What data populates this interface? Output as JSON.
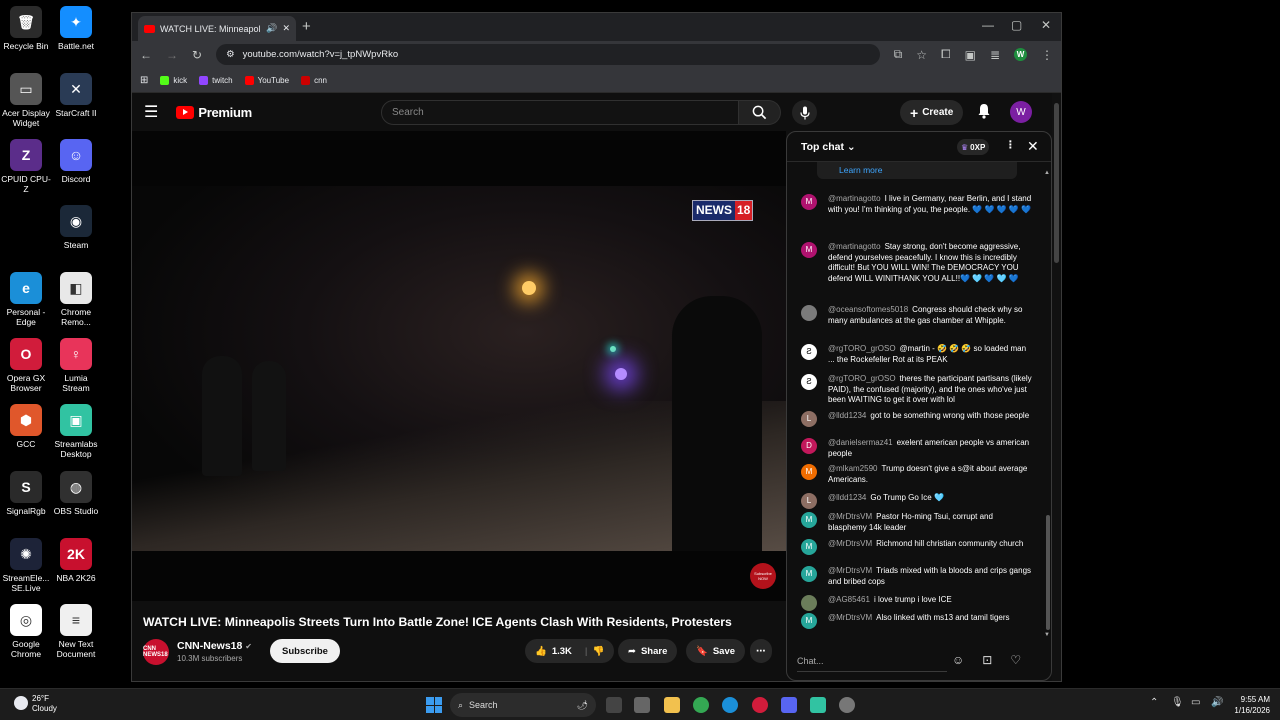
{
  "desktop": {
    "icons": [
      {
        "label": "Recycle Bin",
        "glyph": "🗑",
        "color": "#2b2b2b"
      },
      {
        "label": "Battle.net",
        "glyph": "✦",
        "color": "#148eff"
      },
      {
        "label": "Acer Display Widget",
        "glyph": "▭",
        "color": "#555555"
      },
      {
        "label": "StarCraft II",
        "glyph": "✕",
        "color": "#2a3b55"
      },
      {
        "label": "CPUID CPU-Z",
        "glyph": "Z",
        "color": "#5b2d8a"
      },
      {
        "label": "Discord",
        "glyph": "☺",
        "color": "#5865f2"
      },
      {
        "label": "Steam",
        "glyph": "◉",
        "color": "#1b2838"
      },
      {
        "label": "Personal - Edge",
        "glyph": "e",
        "color": "#1b8fd8"
      },
      {
        "label": "Chrome Remo...",
        "glyph": "◧",
        "color": "#e8e8e8"
      },
      {
        "label": "Opera GX Browser",
        "glyph": "O",
        "color": "#d11c3b"
      },
      {
        "label": "Lumia Stream",
        "glyph": "♀",
        "color": "#e8345a"
      },
      {
        "label": "GCC",
        "glyph": "⬢",
        "color": "#e0572b"
      },
      {
        "label": "Streamlabs Desktop",
        "glyph": "▣",
        "color": "#31c3a2"
      },
      {
        "label": "SignalRgb",
        "glyph": "S",
        "color": "#2a2a2a"
      },
      {
        "label": "OBS Studio",
        "glyph": "◍",
        "color": "#303030"
      },
      {
        "label": "StreamEle... SE.Live",
        "glyph": "✺",
        "color": "#1d2338"
      },
      {
        "label": "NBA 2K26",
        "glyph": "2K",
        "color": "#c8102e"
      },
      {
        "label": "Google Chrome",
        "glyph": "◎",
        "color": "#ffffff"
      },
      {
        "label": "New Text Document",
        "glyph": "≡",
        "color": "#f0f0f0"
      }
    ]
  },
  "browser": {
    "tab_title": "WATCH LIVE: Minneapolis S",
    "new_tab": "+",
    "url": "youtube.com/watch?v=j_tpNWpvRko",
    "profile_initial": "W",
    "bookmarks": [
      {
        "label": "kick",
        "color": "#53fc18"
      },
      {
        "label": "twitch",
        "color": "#9146ff"
      },
      {
        "label": "YouTube",
        "color": "#ff0000"
      },
      {
        "label": "cnn",
        "color": "#cc0000"
      }
    ]
  },
  "youtube": {
    "logo_text": "Premium",
    "search_placeholder": "Search",
    "create_label": "Create",
    "avatar_initial": "W",
    "video": {
      "title": "WATCH LIVE: Minneapolis Streets Turn Into Battle Zone! ICE Agents Clash With Residents, Protesters",
      "news_brand": "NEWS",
      "news_number": "18",
      "subscribe_watermark": "Subscribe NOW"
    },
    "channel": {
      "name": "CNN-News18",
      "subscribers": "10.3M subscribers",
      "subscribe_label": "Subscribe",
      "avatar_text": "CNN NEWS18"
    },
    "actions": {
      "likes": "1.3K",
      "share_label": "Share",
      "save_label": "Save"
    }
  },
  "chat": {
    "header": "Top chat",
    "xp": "0XP",
    "learn_more": "Learn more",
    "input_placeholder": "Chat...",
    "messages": [
      {
        "initial": "M",
        "color": "#b0126f",
        "author": "@martinagotto",
        "text": "I live in Germany, near Berlin, and I stand with you! I'm thinking of you, the people. 💙 💙 💙 💙 💙"
      },
      {
        "initial": "M",
        "color": "#b0126f",
        "author": "@martinagotto",
        "text": "Stay strong, don't become aggressive, defend yourselves peacefully. I know this is incredibly difficult! But YOU WILL WIN! The DEMOCRACY YOU defend WILL WINITHANK YOU ALL!!💙 🩵 💙 🩵 💙"
      },
      {
        "initial": "",
        "color": "#7a7a7a",
        "author": "@oceansoftomes5018",
        "text": "Congress should check why so many ambulances at the gas chamber at Whipple."
      },
      {
        "initial": "Ƨ",
        "color": "#ffffff",
        "author": "@rgTORO_grOSO",
        "text": "@martin - 🤣 🤣 🤣 so loaded man ... the Rockefeller Rot at its PEAK"
      },
      {
        "initial": "Ƨ",
        "color": "#ffffff",
        "author": "@rgTORO_grOSO",
        "text": "theres the participant partisans (likely PAID), the confused (majority), and the ones who've just been WAITING to get it over with lol"
      },
      {
        "initial": "L",
        "color": "#8d6e63",
        "author": "@lldd1234",
        "text": "got to be something wrong with those people"
      },
      {
        "initial": "D",
        "color": "#c2185b",
        "author": "@danielsermaz41",
        "text": "exelent american people vs american people"
      },
      {
        "initial": "M",
        "color": "#ef6c00",
        "author": "@mlkam2590",
        "text": "Trump doesn't give a s@it about average Americans."
      },
      {
        "initial": "L",
        "color": "#8d6e63",
        "author": "@lldd1234",
        "text": "Go Trump Go Ice 🩵"
      },
      {
        "initial": "M",
        "color": "#26a69a",
        "author": "@MrDtrsVM",
        "text": "Pastor Ho-ming Tsui, corrupt and blasphemy 14k leader"
      },
      {
        "initial": "M",
        "color": "#26a69a",
        "author": "@MrDtrsVM",
        "text": "Richmond hill christian community church"
      },
      {
        "initial": "M",
        "color": "#26a69a",
        "author": "@MrDtrsVM",
        "text": "Triads mixed with la bloods and crips gangs and bribed cops"
      },
      {
        "initial": "",
        "color": "#6b7d5a",
        "author": "@AG85461",
        "text": "i love trump i love ICE"
      },
      {
        "initial": "M",
        "color": "#26a69a",
        "author": "@MrDtrsVM",
        "text": "Also linked with ms13 and tamil tigers"
      }
    ]
  },
  "taskbar": {
    "temperature": "26°F",
    "condition": "Cloudy",
    "search_label": "Search",
    "time": "9:55 AM",
    "date": "1/16/2026"
  }
}
